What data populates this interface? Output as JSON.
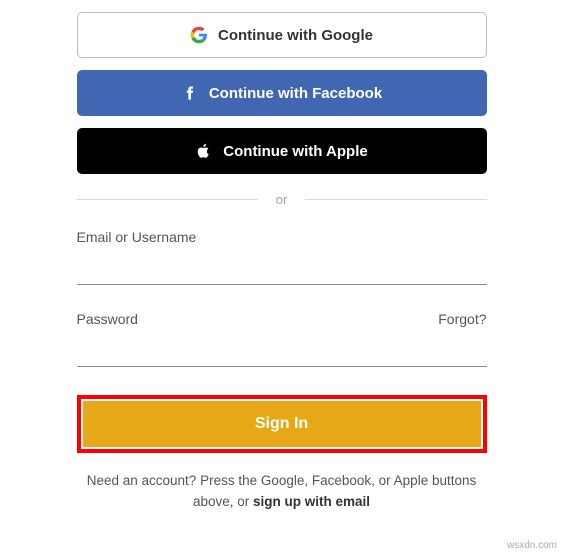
{
  "sso": {
    "google_label": "Continue with Google",
    "facebook_label": "Continue with Facebook",
    "apple_label": "Continue with Apple"
  },
  "divider": {
    "text": "or"
  },
  "fields": {
    "email_label": "Email or Username",
    "password_label": "Password",
    "forgot_label": "Forgot?"
  },
  "actions": {
    "signin_label": "Sign In"
  },
  "footer": {
    "prefix": "Need an account? Press the Google, Facebook, or Apple buttons above, or ",
    "signup_link": "sign up with email"
  },
  "watermark": "wsxdn.com"
}
